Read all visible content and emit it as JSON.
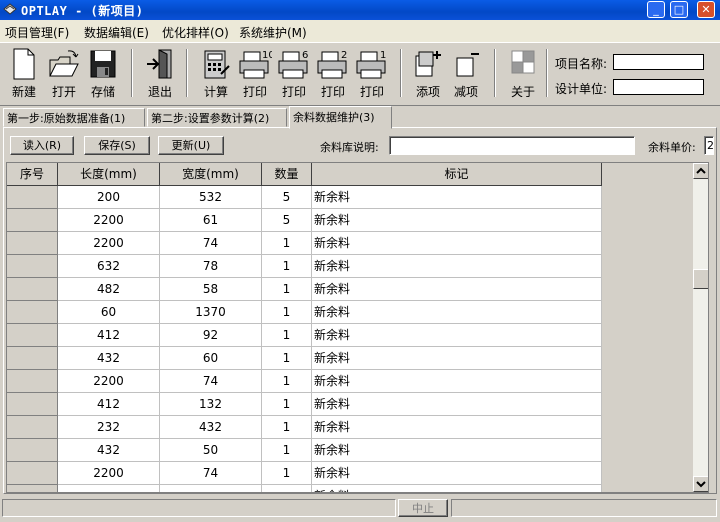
{
  "window": {
    "title": "OPTLAY - (新项目)",
    "minimize": "_",
    "maximize": "□",
    "close": "✕"
  },
  "menu": [
    "项目管理(F)",
    "数据编辑(E)",
    "优化排样(O)",
    "系统维护(M)"
  ],
  "toolbar": {
    "new": "新建",
    "open": "打开",
    "save": "存储",
    "exit": "退出",
    "calc": "计算",
    "print1": "打印",
    "print2": "打印",
    "print3": "打印",
    "print4": "打印",
    "add": "添项",
    "remove": "减项",
    "about": "关于",
    "print_badges": [
      "10",
      "6",
      "2",
      "1"
    ]
  },
  "project": {
    "name_label": "项目名称:",
    "name_value": "",
    "unit_label": "设计单位:",
    "unit_value": ""
  },
  "tabs": [
    "第一步:原始数据准备(1)",
    "第二步:设置参数计算(2)",
    "余料数据维护(3)"
  ],
  "active_tab": 2,
  "panel": {
    "read_btn": "读入(R)",
    "save_btn": "保存(S)",
    "update_btn": "更新(U)",
    "desc_label": "余料库说明:",
    "desc_value": "",
    "price_label": "余料单价:",
    "price_value": "2"
  },
  "table": {
    "headers": [
      "序号",
      "长度(mm)",
      "宽度(mm)",
      "数量",
      "标记"
    ],
    "rows": [
      [
        "",
        "200",
        "532",
        "5",
        "新余料"
      ],
      [
        "",
        "2200",
        "61",
        "5",
        "新余料"
      ],
      [
        "",
        "2200",
        "74",
        "1",
        "新余料"
      ],
      [
        "",
        "632",
        "78",
        "1",
        "新余料"
      ],
      [
        "",
        "482",
        "58",
        "1",
        "新余料"
      ],
      [
        "",
        "60",
        "1370",
        "1",
        "新余料"
      ],
      [
        "",
        "412",
        "92",
        "1",
        "新余料"
      ],
      [
        "",
        "432",
        "60",
        "1",
        "新余料"
      ],
      [
        "",
        "2200",
        "74",
        "1",
        "新余料"
      ],
      [
        "",
        "412",
        "132",
        "1",
        "新余料"
      ],
      [
        "",
        "232",
        "432",
        "1",
        "新余料"
      ],
      [
        "",
        "432",
        "50",
        "1",
        "新余料"
      ],
      [
        "",
        "2200",
        "74",
        "1",
        "新余料"
      ],
      [
        "",
        "",
        "",
        "",
        "新余料"
      ]
    ]
  },
  "status": {
    "stop": "中止"
  },
  "colors": {
    "titlebar": "#0a5ce6",
    "face": "#d4d0c8",
    "menubar": "#ece9d8"
  }
}
